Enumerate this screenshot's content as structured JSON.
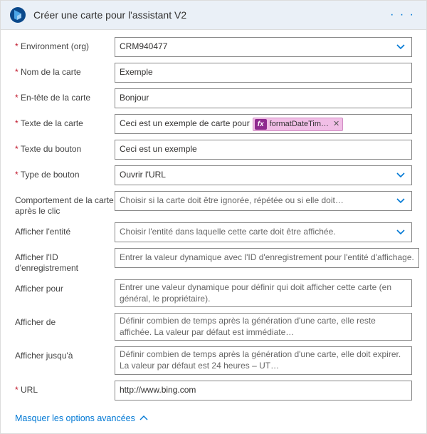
{
  "header": {
    "title": "Créer une carte pour l'assistant V2",
    "menu_icon": "more-icon"
  },
  "fields": {
    "environment": {
      "label": "Environment (org)",
      "value": "CRM940477",
      "required": true,
      "type": "select"
    },
    "card_name": {
      "label": "Nom de la carte",
      "value": "Exemple",
      "required": true,
      "type": "text"
    },
    "card_header": {
      "label": "En-tête de la carte",
      "value": "Bonjour",
      "required": true,
      "type": "text"
    },
    "card_text": {
      "label": "Texte de la carte",
      "value": "Ceci est un exemple de carte pour",
      "chip": "formatDateTim…",
      "required": true,
      "type": "chip"
    },
    "button_text": {
      "label": "Texte du bouton",
      "value": "Ceci est un exemple",
      "required": true,
      "type": "text"
    },
    "button_type": {
      "label": "Type de bouton",
      "value": "Ouvrir l'URL",
      "required": true,
      "type": "select"
    },
    "behavior": {
      "label": "Comportement de la carte après le clic",
      "value": "Choisir si la carte doit être ignorée, répétée ou si elle doit…",
      "required": false,
      "type": "select",
      "placeholder": true
    },
    "show_entity": {
      "label": "Afficher l'entité",
      "value": "Choisir l'entité dans laquelle cette carte doit être affichée.",
      "required": false,
      "type": "select",
      "placeholder": true
    },
    "record_id": {
      "label": "Afficher l'ID d'enregistrement",
      "value": "Entrer la valeur dynamique avec l'ID d'enregistrement pour l'entité d'affichage.",
      "required": false,
      "type": "text",
      "placeholder": true
    },
    "show_for": {
      "label": "Afficher pour",
      "value": "Entrer une valeur dynamique pour définir qui doit afficher cette carte (en général, le propriétaire).",
      "required": false,
      "type": "multiline",
      "placeholder": true
    },
    "show_from": {
      "label": "Afficher de",
      "value": "Définir combien de temps après la génération d'une carte, elle reste affichée. La valeur par défaut est immédiate…",
      "required": false,
      "type": "multiline",
      "placeholder": true
    },
    "show_until": {
      "label": "Afficher jusqu'à",
      "value": "Définir combien de temps après la génération d'une carte, elle doit expirer. La valeur par défaut est 24 heures – UT…",
      "required": false,
      "type": "multiline",
      "placeholder": true
    },
    "url": {
      "label": "URL",
      "value": "http://www.bing.com",
      "required": true,
      "type": "text"
    }
  },
  "footer": {
    "toggle_label": "Masquer les options avancées"
  },
  "colors": {
    "accent": "#0078d4",
    "required": "#c0172b",
    "chip_bg": "#f1bee6",
    "chip_icon_bg": "#8f2b8f"
  }
}
